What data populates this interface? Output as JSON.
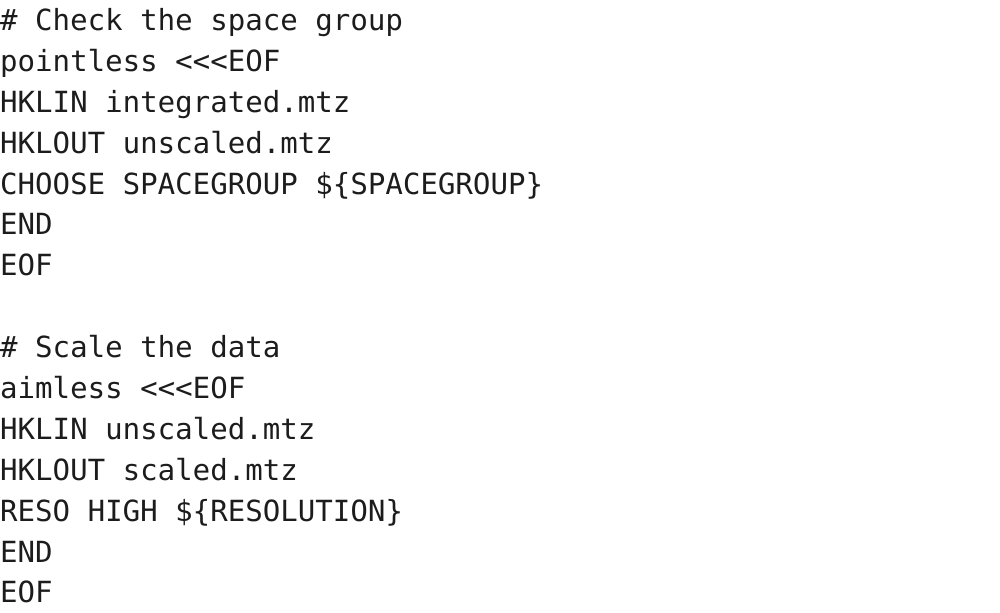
{
  "document": {
    "type": "shell-script-snippet",
    "background_color": "#ffffff",
    "text_color": "#1c1c1c",
    "font_size_px": 29,
    "line_height_px": 41
  },
  "code": {
    "lines": [
      {
        "text": "# Check the space group",
        "kind": "comment"
      },
      {
        "text": "pointless <<<EOF",
        "kind": "command"
      },
      {
        "text": "HKLIN integrated.mtz",
        "kind": "keyword-arg"
      },
      {
        "text": "HKLOUT unscaled.mtz",
        "kind": "keyword-arg"
      },
      {
        "text": "CHOOSE SPACEGROUP ${SPACEGROUP}",
        "kind": "keyword-arg"
      },
      {
        "text": "END",
        "kind": "keyword"
      },
      {
        "text": "EOF",
        "kind": "heredoc-terminator"
      },
      {
        "text": "",
        "kind": "blank"
      },
      {
        "text": "# Scale the data",
        "kind": "comment"
      },
      {
        "text": "aimless <<<EOF",
        "kind": "command"
      },
      {
        "text": "HKLIN unscaled.mtz",
        "kind": "keyword-arg"
      },
      {
        "text": "HKLOUT scaled.mtz",
        "kind": "keyword-arg"
      },
      {
        "text": "RESO HIGH ${RESOLUTION}",
        "kind": "keyword-arg"
      },
      {
        "text": "END",
        "kind": "keyword"
      },
      {
        "text": "EOF",
        "kind": "heredoc-terminator"
      }
    ]
  }
}
